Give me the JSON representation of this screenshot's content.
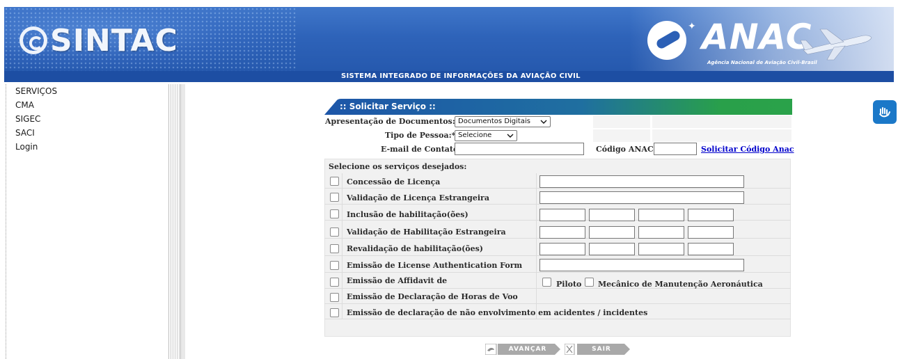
{
  "header": {
    "app_logo_text": "SINTAC",
    "agency_logo_text": "ANAC",
    "agency_subtitle": "Agência Nacional de Aviação Civil-Brasil",
    "system_title": "SISTEMA INTEGRADO DE INFORMAÇÕES DA AVIAÇÃO CIVIL"
  },
  "sidebar": {
    "items": [
      {
        "label": "SERVIÇOS"
      },
      {
        "label": "CMA"
      },
      {
        "label": "SIGEC"
      },
      {
        "label": "SACI"
      },
      {
        "label": "Login"
      }
    ]
  },
  "form": {
    "title": ":: Solicitar Serviço ::",
    "document_presentation_label": "Apresentação de Documentos:*",
    "document_presentation_value": "Documentos Digitais",
    "person_type_label": "Tipo de Pessoa:*",
    "person_type_value": "Selecione",
    "contact_email_label": "E-mail de Contato",
    "contact_email_value": "",
    "anac_code_label": "Código ANAC:",
    "anac_code_value": "",
    "request_code_link": "Solicitar Código Anac",
    "services_header": "Selecione os serviços desejados:",
    "services": [
      {
        "label": "Concessão de Licença"
      },
      {
        "label": "Validação de Licença Estrangeira"
      },
      {
        "label": "Inclusão de habilitação(ões)"
      },
      {
        "label": "Validação de Habilitação Estrangeira"
      },
      {
        "label": "Revalidação de habilitação(ões)"
      },
      {
        "label": "Emissão de License Authentication Form"
      },
      {
        "label": "Emissão de Affidavit de"
      },
      {
        "label": "Emissão de Declaração de Horas de Voo"
      },
      {
        "label": "Emissão de declaração de não envolvimento em acidentes / incidentes"
      }
    ],
    "affidavit_options": {
      "pilot": "Piloto",
      "mechanic": "Mecânico de Manutenção Aeronáutica"
    }
  },
  "actions": {
    "next": "AVANÇAR",
    "exit": "SAIR"
  },
  "colors": {
    "header_blue": "#2e63b9",
    "title_bar_blue": "#1f5aa8",
    "title_bar_green": "#2aa24a",
    "link_blue": "#0000cc",
    "button_gray": "#a9a9a9"
  }
}
